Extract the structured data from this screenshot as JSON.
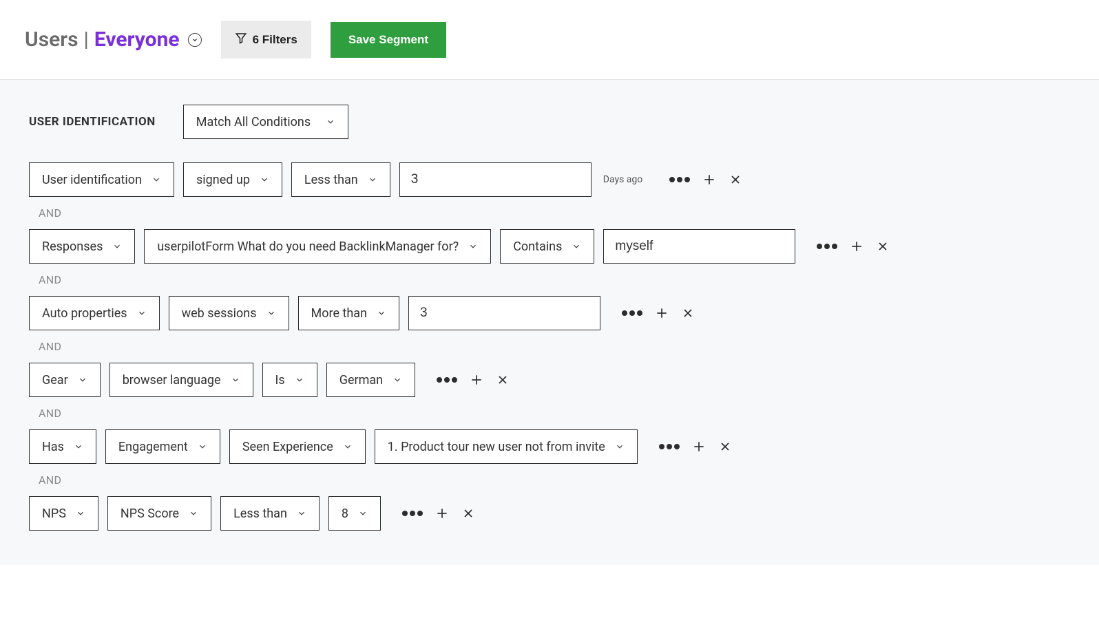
{
  "header": {
    "title_users": "Users",
    "title_pipe": "|",
    "title_everyone": "Everyone",
    "filters_label": "6 Filters",
    "save_label": "Save Segment"
  },
  "section": {
    "title": "USER IDENTIFICATION",
    "match_mode": "Match All Conditions"
  },
  "and": "AND",
  "rows": [
    {
      "c1": "User identification",
      "c2": "signed up",
      "c3": "Less than",
      "input": "3",
      "suffix": "Days ago"
    },
    {
      "c1": "Responses",
      "c2": "userpilotForm What do you need BacklinkManager for?",
      "c3": "Contains",
      "input": "myself"
    },
    {
      "c1": "Auto properties",
      "c2": "web sessions",
      "c3": "More than",
      "input": "3"
    },
    {
      "c1": "Gear",
      "c2": "browser language",
      "c3": "Is",
      "c4": "German"
    },
    {
      "c1": "Has",
      "c2": "Engagement",
      "c3": "Seen Experience",
      "c4": "1. Product tour new user not from invite"
    },
    {
      "c1": "NPS",
      "c2": "NPS Score",
      "c3": "Less than",
      "c4": "8"
    }
  ]
}
